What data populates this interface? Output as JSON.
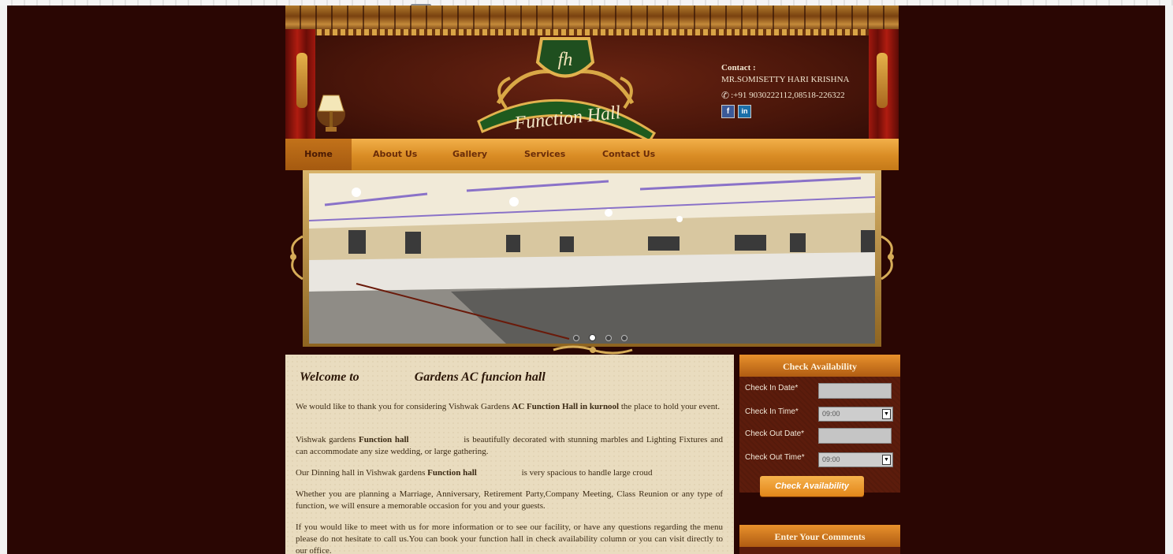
{
  "header": {
    "logo_monogram": "fh",
    "logo_text": "Function Hall",
    "contact_label": "Contact :",
    "contact_name": "MR.SOMISETTY HARI KRISHNA",
    "contact_phone": ":+91 9030222112,08518-226322",
    "social": [
      "f",
      "in"
    ]
  },
  "nav": {
    "items": [
      {
        "label": "Home",
        "active": true
      },
      {
        "label": "About Us"
      },
      {
        "label": "Gallery"
      },
      {
        "label": "Services"
      },
      {
        "label": "Contact Us"
      }
    ]
  },
  "slider": {
    "slide_count": 4,
    "active_index": 1
  },
  "main": {
    "welcome_prefix": "Welcome to",
    "welcome_suffix": "Gardens AC funcion hall",
    "p1_a": "We would like to thank you for considering Vishwak Gardens ",
    "p1_bold": "AC Function Hall in kurnool",
    "p1_b": " the place to hold your event.",
    "p2_a": "Vishwak gardens ",
    "p2_bold": "Function hall",
    "p2_b": " is beautifully decorated with stunning marbles and Lighting Fixtures and can accommodate any size wedding, or large gathering.",
    "p3_a": "Our Dinning hall in Vishwak gardens ",
    "p3_bold": "Function hall",
    "p3_b": " is very spacious to handle large croud",
    "p4": "Whether you are planning a Marriage, Anniversary, Retirement Party,Company Meeting, Class Reunion or any type of function, we will ensure a memorable occasion for you and your guests.",
    "p5": "If you would like to meet with us for more information or to see our facility, or have any questions regarding the menu please do not hesitate to call us.You can book your function hall in check availability column or you can visit directly to our office."
  },
  "availability": {
    "title": "Check Availability",
    "check_in_date_label": "Check In Date*",
    "check_in_date_value": "",
    "check_in_time_label": "Check In Time*",
    "check_in_time_value": "09:00",
    "check_out_date_label": "Check Out Date*",
    "check_out_date_value": "",
    "check_out_time_label": "Check Out Time*",
    "check_out_time_value": "09:00",
    "button_label": "Check Availability"
  },
  "comments": {
    "title": "Enter Your Comments"
  }
}
